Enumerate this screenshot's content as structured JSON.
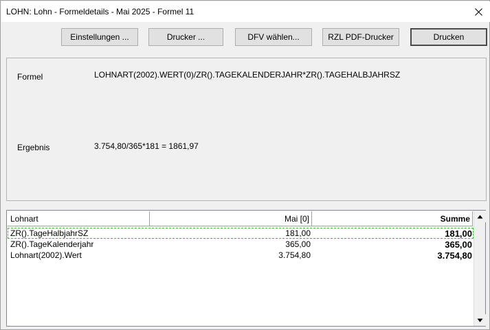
{
  "window": {
    "title": "LOHN: Lohn - Formeldetails - Mai 2025 - Formel 11",
    "close_icon": "close-icon"
  },
  "toolbar": {
    "settings_label": "Einstellungen ...",
    "printer_label": "Drucker ...",
    "dfv_label": "DFV wählen...",
    "rzl_label": "RZL PDF-Drucker",
    "print_label": "Drucken"
  },
  "formula": {
    "formula_label": "Formel",
    "formula_value": "LOHNART(2002).WERT(0)/ZR().TAGEKALENDERJAHR*ZR().TAGEHALBJAHRSZ",
    "result_label": "Ergebnis",
    "result_value": "3.754,80/365*181 = 1861,97"
  },
  "grid": {
    "columns": [
      "Lohnart",
      "Mai [0]",
      "Summe"
    ],
    "rows": [
      {
        "lohnart": "ZR().TageHalbjahrSZ",
        "mai": "181,00",
        "summe": "181,00"
      },
      {
        "lohnart": "ZR().TageKalenderjahr",
        "mai": "365,00",
        "summe": "365,00"
      },
      {
        "lohnart": "Lohnart(2002).Wert",
        "mai": "3.754,80",
        "summe": "3.754,80"
      }
    ],
    "focus_color": "#2fc42f"
  },
  "scrollbar": {
    "up_icon": "scroll-up-arrow-icon",
    "down_icon": "scroll-down-arrow-icon"
  }
}
